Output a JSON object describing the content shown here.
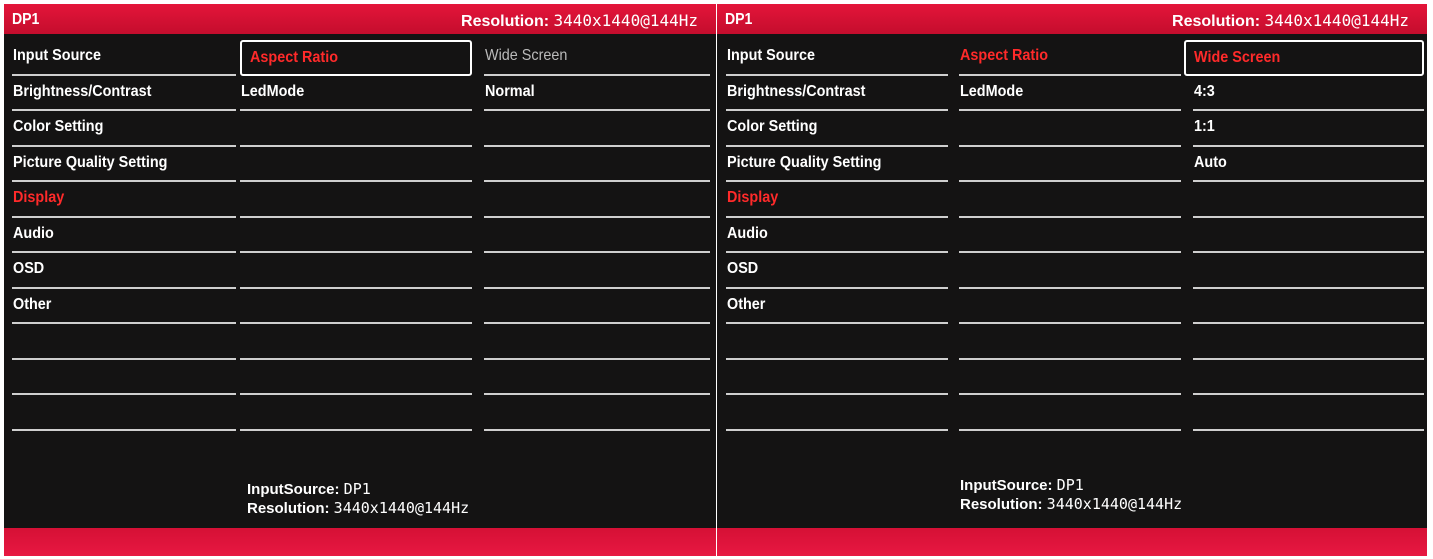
{
  "left_panel": {
    "title": "DP1",
    "resolution_label": "Resolution:",
    "resolution_value": "3440x1440@144Hz",
    "menu": [
      "Input Source",
      "Brightness/Contrast",
      "Color Setting",
      "Picture Quality Setting",
      "Display",
      "Audio",
      "OSD",
      "Other",
      "",
      "",
      ""
    ],
    "sub_menu": [
      "Aspect Ratio",
      "LedMode",
      "",
      "",
      "",
      "",
      "",
      "",
      "",
      "",
      ""
    ],
    "values": [
      "Wide Screen",
      "Normal",
      "",
      "",
      "",
      "",
      "",
      "",
      "",
      "",
      ""
    ],
    "footer_input_label": "InputSource:",
    "footer_input_value": "DP1",
    "footer_res_label": "Resolution:",
    "footer_res_value": "3440x1440@144Hz"
  },
  "right_panel": {
    "title": "DP1",
    "resolution_label": "Resolution:",
    "resolution_value": "3440x1440@144Hz",
    "menu": [
      "Input Source",
      "Brightness/Contrast",
      "Color Setting",
      "Picture Quality Setting",
      "Display",
      "Audio",
      "OSD",
      "Other",
      "",
      "",
      ""
    ],
    "sub_menu": [
      "Aspect Ratio",
      "LedMode",
      "",
      "",
      "",
      "",
      "",
      "",
      "",
      "",
      ""
    ],
    "values": [
      "Wide Screen",
      "4:3",
      "1:1",
      "Auto",
      "",
      "",
      "",
      "",
      "",
      "",
      ""
    ],
    "footer_input_label": "InputSource:",
    "footer_input_value": "DP1",
    "footer_res_label": "Resolution:",
    "footer_res_value": "3440x1440@144Hz"
  },
  "colors": {
    "bar_red": "#e4153a",
    "background": "#141313",
    "highlight_text": "#ff2a2a",
    "text": "#ffffff"
  }
}
